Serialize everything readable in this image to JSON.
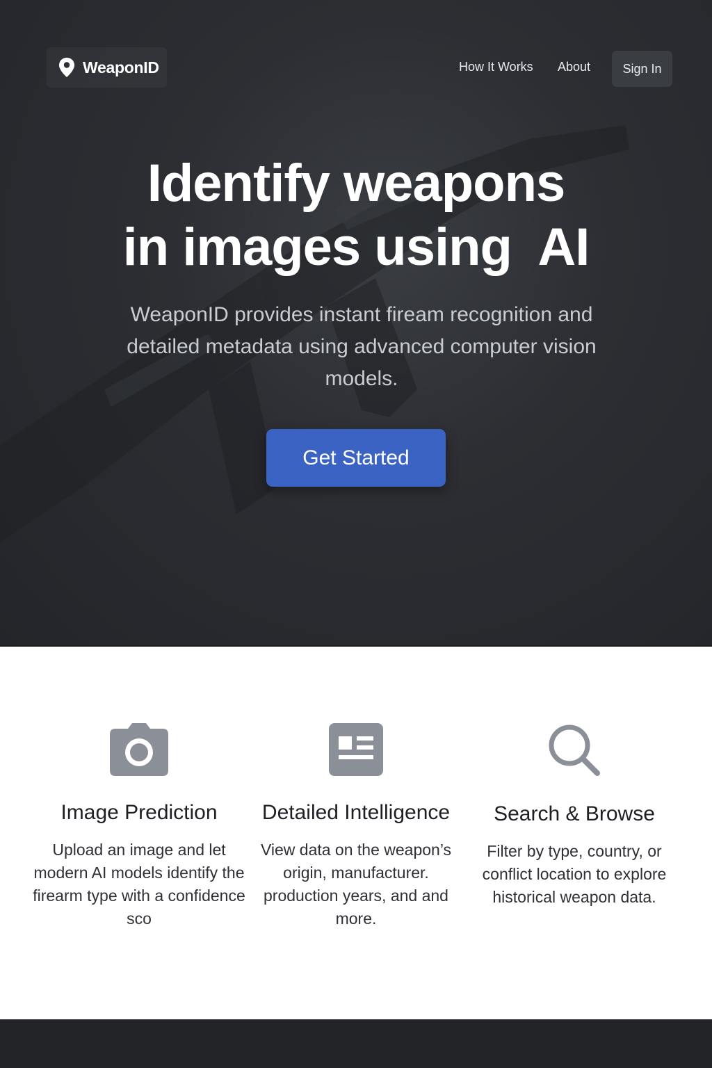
{
  "nav": {
    "brand_name": "WeaponID",
    "links": [
      {
        "label": "How It Works"
      },
      {
        "label": "About"
      }
    ],
    "sign_in_label": "Sign In"
  },
  "hero": {
    "title_line1": "Identify weapons",
    "title_line2": "in images using  AI",
    "subtitle": "WeaponID provides instant fiream recognition and detailed metadata using advanced computer vision models.",
    "cta_label": "Get Started"
  },
  "features": [
    {
      "icon": "camera-icon",
      "title": "Image Prediction",
      "description": "Upload an image and let modern AI models identify the firearm type with a confidence sco"
    },
    {
      "icon": "newspaper-icon",
      "title": "Detailed Intelligence",
      "description": "View data on the weapon’s origin, manufacturer. production years, and and more."
    },
    {
      "icon": "search-icon",
      "title": "Search & Browse",
      "description": "Filter by type, country, or conflict location to explore historical weapon data."
    }
  ],
  "colors": {
    "hero_bg": "#2c2e33",
    "accent": "#3b63c4",
    "icon_gray": "#8a8f98",
    "footer_bg": "#222428"
  }
}
